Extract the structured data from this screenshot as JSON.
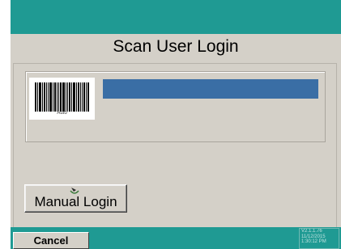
{
  "header": {
    "title": "Scan User Login"
  },
  "barcode": {
    "caption": "Auto",
    "icon": "barcode-icon"
  },
  "scan_field": {
    "value": ""
  },
  "manual_login": {
    "label": "Manual Login",
    "icon": "pointer-icon"
  },
  "footer": {
    "cancel_label": "Cancel",
    "version_lines": [
      "V2.1.1.76",
      "11/12/2015",
      "1:30:12 PM"
    ]
  },
  "colors": {
    "bar": "#1f9a93",
    "background": "#d4d0c8",
    "input": "#3a6ea5"
  }
}
